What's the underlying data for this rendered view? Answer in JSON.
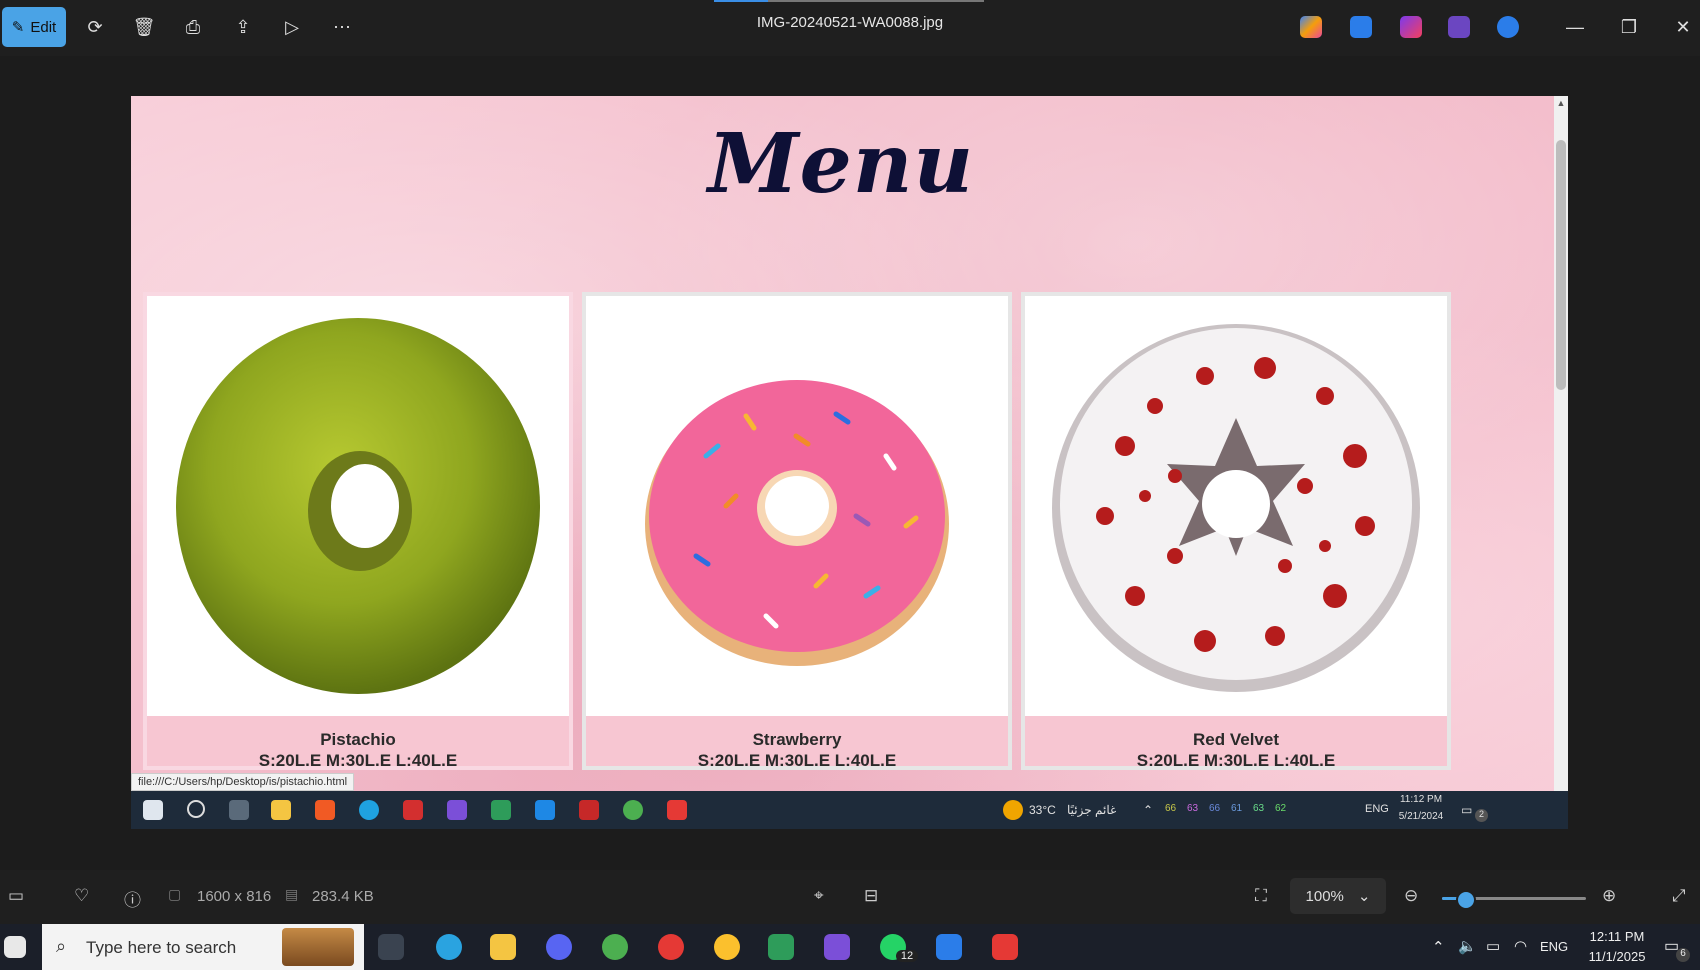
{
  "toolbar": {
    "edit_label": "Edit",
    "file_name": "IMG-20240521-WA0088.jpg",
    "icons": [
      "rotate-icon",
      "delete-icon",
      "print-icon",
      "share-icon",
      "slideshow-icon",
      "more-icon"
    ]
  },
  "window": {
    "minimize": "—",
    "restore": "❐",
    "close": "✕"
  },
  "photo": {
    "menu_title": "Menu",
    "items": [
      {
        "name": "Pistachio",
        "price": "S:20L.E M:30L.E L:40L.E"
      },
      {
        "name": "Strawberry",
        "price": "S:20L.E M:30L.E L:40L.E"
      },
      {
        "name": "Red Velvet",
        "price": "S:20L.E M:30L.E L:40L.E"
      }
    ],
    "status_url": "file:///C:/Users/hp/Desktop/is/pistachio.html",
    "inner_taskbar": {
      "weather": "33°C",
      "weather_desc": "غائم جزئيًا",
      "lang": "ENG",
      "time": "11:12 PM",
      "date": "5/21/2024",
      "notif_count": "2",
      "tray_numbers": [
        "66",
        "63",
        "66",
        "61",
        "63",
        "62"
      ]
    }
  },
  "bottombar": {
    "dimensions": "1600 x 816",
    "file_size": "283.4 KB",
    "zoom": "100%",
    "zoom_level": 0.15
  },
  "taskbar": {
    "search_placeholder": "Type here to search",
    "lang": "ENG",
    "time": "12:11 PM",
    "date": "11/1/2025",
    "whatsapp_badge": "12",
    "notif_count": "6"
  },
  "colors": {
    "accent": "#4aa3e6",
    "menu_title": "#0e1036",
    "paper_pink": "#f6c3d0"
  }
}
